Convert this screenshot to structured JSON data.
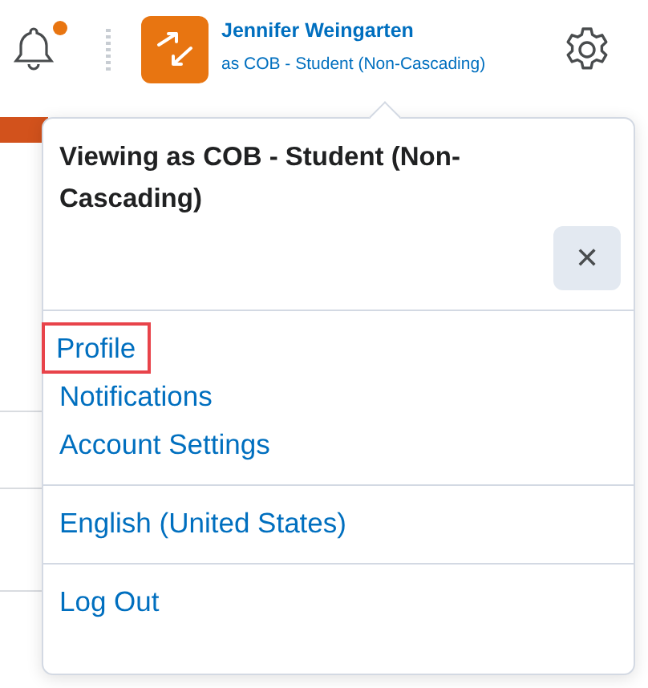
{
  "header": {
    "notification_dot": true,
    "user_name": "Jennifer Weingarten",
    "role": "as COB - Student (Non-Cascading)"
  },
  "menu": {
    "title": "Viewing as COB - Student (Non-Cascading)",
    "close_label": "✕",
    "groups": [
      {
        "items": [
          {
            "label": "Profile",
            "highlighted": true
          },
          {
            "label": "Notifications",
            "highlighted": false
          },
          {
            "label": "Account Settings",
            "highlighted": false
          }
        ]
      },
      {
        "items": [
          {
            "label": "English (United States)",
            "highlighted": false
          }
        ]
      },
      {
        "items": [
          {
            "label": "Log Out",
            "highlighted": false
          }
        ]
      }
    ]
  }
}
